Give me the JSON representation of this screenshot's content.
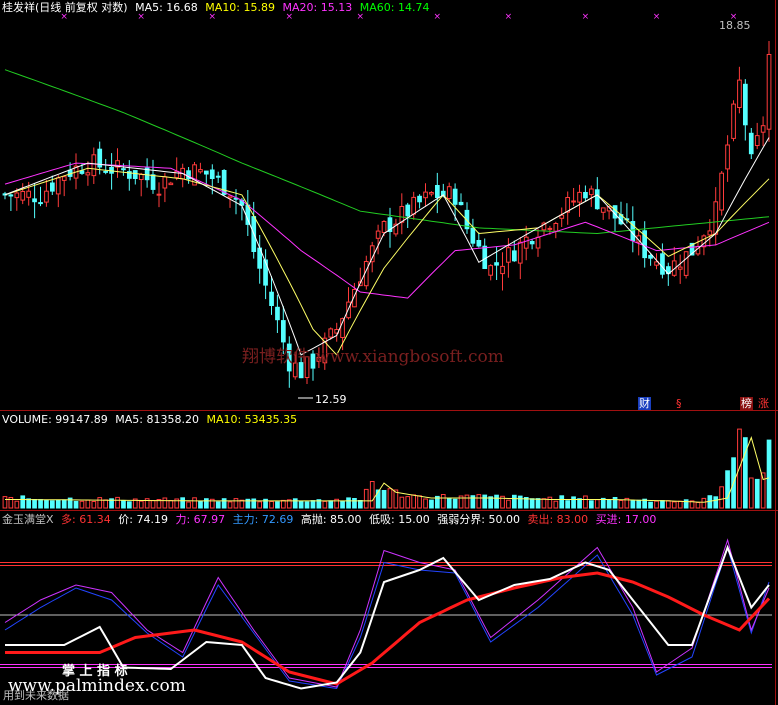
{
  "panel_main": {
    "title": "桂发祥(日线 前复权 对数)",
    "ma_items": [
      {
        "label": "MA5: 16.68",
        "color": "#ffffff"
      },
      {
        "label": "MA10: 15.89",
        "color": "#ffff00"
      },
      {
        "label": "MA20: 15.13",
        "color": "#ff33ff"
      },
      {
        "label": "MA60: 14.74",
        "color": "#00ff00"
      }
    ],
    "high_label": "18.85",
    "low_label": "12.59",
    "watermark": "翔博软件 www.xiangbosoft.com",
    "tags": {
      "cai": "财",
      "s": "§",
      "bang": "榜",
      "zhang": "涨"
    }
  },
  "panel_volume": {
    "items": [
      {
        "label": "VOLUME: 99147.89",
        "color": "#ffffff"
      },
      {
        "label": "MA5: 81358.20",
        "color": "#ffffff"
      },
      {
        "label": "MA10: 53435.35",
        "color": "#ffff00"
      }
    ]
  },
  "panel_indicator": {
    "items": [
      {
        "label": "金玉满堂X",
        "color": "#c0c0c0"
      },
      {
        "label": "多: 61.34",
        "color": "#ff3333"
      },
      {
        "label": "价: 74.19",
        "color": "#ffffff"
      },
      {
        "label": "力: 67.97",
        "color": "#ff33ff"
      },
      {
        "label": "主力: 72.69",
        "color": "#3399ff"
      },
      {
        "label": "高抛: 85.00",
        "color": "#ffffff"
      },
      {
        "label": "低吸: 15.00",
        "color": "#ffffff"
      },
      {
        "label": "强弱分界: 50.00",
        "color": "#ffffff"
      },
      {
        "label": "卖出: 83.00",
        "color": "#ff3333"
      },
      {
        "label": "买进: 17.00",
        "color": "#ff33ff"
      }
    ],
    "watermark_cn": "掌 上 指 标",
    "watermark_url": "www.palmindex.com",
    "bottom_text": "用到未来数据"
  },
  "chart_data": [
    {
      "type": "candlestick",
      "scale": "log",
      "ylim": [
        12.3,
        19.2
      ],
      "count": 130,
      "highest": 18.85,
      "lowest": 12.59,
      "price_anchors": [
        [
          0,
          15.6
        ],
        [
          6,
          15.6
        ],
        [
          10,
          16.0
        ],
        [
          14,
          16.2
        ],
        [
          18,
          16.1
        ],
        [
          22,
          16.0
        ],
        [
          26,
          15.8
        ],
        [
          30,
          16.1
        ],
        [
          34,
          16.0
        ],
        [
          38,
          15.7
        ],
        [
          40,
          15.4
        ],
        [
          42,
          14.6
        ],
        [
          44,
          14.0
        ],
        [
          46,
          13.4
        ],
        [
          48,
          12.8
        ],
        [
          50,
          12.65
        ],
        [
          52,
          12.8
        ],
        [
          56,
          13.3
        ],
        [
          60,
          14.2
        ],
        [
          64,
          15.0
        ],
        [
          68,
          15.3
        ],
        [
          72,
          15.6
        ],
        [
          76,
          15.6
        ],
        [
          78,
          15.0
        ],
        [
          82,
          14.3
        ],
        [
          86,
          14.6
        ],
        [
          90,
          15.0
        ],
        [
          94,
          15.3
        ],
        [
          98,
          15.7
        ],
        [
          100,
          15.5
        ],
        [
          104,
          15.1
        ],
        [
          108,
          14.6
        ],
        [
          112,
          14.3
        ],
        [
          116,
          14.6
        ],
        [
          120,
          15.3
        ],
        [
          124,
          17.8
        ],
        [
          126,
          16.2
        ],
        [
          128,
          17.0
        ],
        [
          129,
          18.4
        ]
      ],
      "ma60_anchors": [
        [
          0,
          18.1
        ],
        [
          20,
          17.2
        ],
        [
          40,
          16.2
        ],
        [
          60,
          15.3
        ],
        [
          80,
          15.0
        ],
        [
          100,
          14.9
        ],
        [
          129,
          15.2
        ]
      ],
      "ma20_anchors": [
        [
          0,
          15.8
        ],
        [
          12,
          16.2
        ],
        [
          28,
          16.1
        ],
        [
          40,
          15.5
        ],
        [
          50,
          14.6
        ],
        [
          60,
          13.9
        ],
        [
          68,
          13.8
        ],
        [
          76,
          14.6
        ],
        [
          86,
          14.7
        ],
        [
          98,
          15.1
        ],
        [
          110,
          14.6
        ],
        [
          120,
          14.7
        ],
        [
          129,
          15.1
        ]
      ],
      "ma10_anchors": [
        [
          0,
          15.6
        ],
        [
          14,
          16.1
        ],
        [
          30,
          15.9
        ],
        [
          40,
          15.6
        ],
        [
          52,
          13.3
        ],
        [
          56,
          12.9
        ],
        [
          64,
          14.3
        ],
        [
          74,
          15.6
        ],
        [
          80,
          14.9
        ],
        [
          90,
          15.0
        ],
        [
          100,
          15.6
        ],
        [
          112,
          14.5
        ],
        [
          120,
          14.9
        ],
        [
          129,
          15.9
        ]
      ],
      "ma5_anchors": [
        [
          0,
          15.6
        ],
        [
          14,
          16.2
        ],
        [
          30,
          16.0
        ],
        [
          40,
          15.4
        ],
        [
          50,
          12.9
        ],
        [
          56,
          13.2
        ],
        [
          64,
          14.9
        ],
        [
          74,
          15.6
        ],
        [
          80,
          14.4
        ],
        [
          90,
          15.0
        ],
        [
          100,
          15.6
        ],
        [
          112,
          14.2
        ],
        [
          120,
          14.9
        ],
        [
          129,
          16.7
        ]
      ],
      "marker_count": 10
    },
    {
      "type": "bar",
      "name": "VOLUME",
      "volume_anchors": [
        [
          0,
          12
        ],
        [
          30,
          10
        ],
        [
          60,
          10
        ],
        [
          62,
          35
        ],
        [
          64,
          22
        ],
        [
          70,
          14
        ],
        [
          80,
          14
        ],
        [
          90,
          12
        ],
        [
          100,
          12
        ],
        [
          110,
          10
        ],
        [
          116,
          8
        ],
        [
          120,
          14
        ],
        [
          124,
          99
        ],
        [
          126,
          40
        ],
        [
          128,
          45
        ],
        [
          129,
          85
        ]
      ],
      "ylim": [
        0,
        105
      ]
    },
    {
      "type": "line",
      "name": "金玉满堂X",
      "ylim": [
        0,
        100
      ],
      "reference_lines": [
        85,
        50,
        15,
        83,
        17
      ],
      "series": [
        {
          "name": "价",
          "anchors": [
            [
              0,
              30
            ],
            [
              10,
              30
            ],
            [
              16,
              42
            ],
            [
              20,
              15
            ],
            [
              28,
              14
            ],
            [
              34,
              32
            ],
            [
              40,
              30
            ],
            [
              44,
              8
            ],
            [
              50,
              1
            ],
            [
              56,
              5
            ],
            [
              60,
              25
            ],
            [
              64,
              72
            ],
            [
              70,
              80
            ],
            [
              74,
              88
            ],
            [
              80,
              60
            ],
            [
              86,
              70
            ],
            [
              92,
              74
            ],
            [
              98,
              85
            ],
            [
              102,
              80
            ],
            [
              108,
              50
            ],
            [
              112,
              30
            ],
            [
              116,
              30
            ],
            [
              122,
              95
            ],
            [
              126,
              55
            ],
            [
              129,
              70
            ]
          ]
        },
        {
          "name": "多",
          "anchors": [
            [
              0,
              25
            ],
            [
              16,
              25
            ],
            [
              22,
              35
            ],
            [
              32,
              40
            ],
            [
              40,
              32
            ],
            [
              48,
              12
            ],
            [
              56,
              4
            ],
            [
              62,
              18
            ],
            [
              70,
              45
            ],
            [
              78,
              60
            ],
            [
              86,
              68
            ],
            [
              94,
              75
            ],
            [
              100,
              78
            ],
            [
              106,
              72
            ],
            [
              112,
              62
            ],
            [
              118,
              50
            ],
            [
              124,
              40
            ],
            [
              129,
              61
            ]
          ]
        },
        {
          "name": "力",
          "anchors": [
            [
              0,
              45
            ],
            [
              6,
              60
            ],
            [
              12,
              70
            ],
            [
              18,
              65
            ],
            [
              24,
              40
            ],
            [
              30,
              25
            ],
            [
              36,
              75
            ],
            [
              42,
              40
            ],
            [
              48,
              8
            ],
            [
              56,
              2
            ],
            [
              60,
              40
            ],
            [
              64,
              93
            ],
            [
              70,
              85
            ],
            [
              76,
              80
            ],
            [
              82,
              35
            ],
            [
              90,
              60
            ],
            [
              100,
              95
            ],
            [
              106,
              55
            ],
            [
              110,
              12
            ],
            [
              116,
              28
            ],
            [
              122,
              100
            ],
            [
              126,
              40
            ],
            [
              129,
              68
            ]
          ]
        },
        {
          "name": "主力",
          "anchors": [
            [
              0,
              40
            ],
            [
              6,
              55
            ],
            [
              12,
              68
            ],
            [
              18,
              60
            ],
            [
              24,
              38
            ],
            [
              30,
              22
            ],
            [
              36,
              70
            ],
            [
              42,
              38
            ],
            [
              48,
              6
            ],
            [
              56,
              1
            ],
            [
              60,
              35
            ],
            [
              64,
              85
            ],
            [
              70,
              80
            ],
            [
              76,
              78
            ],
            [
              82,
              32
            ],
            [
              90,
              55
            ],
            [
              100,
              90
            ],
            [
              106,
              50
            ],
            [
              110,
              10
            ],
            [
              116,
              22
            ],
            [
              122,
              95
            ],
            [
              126,
              38
            ],
            [
              129,
              72
            ]
          ]
        }
      ]
    }
  ]
}
